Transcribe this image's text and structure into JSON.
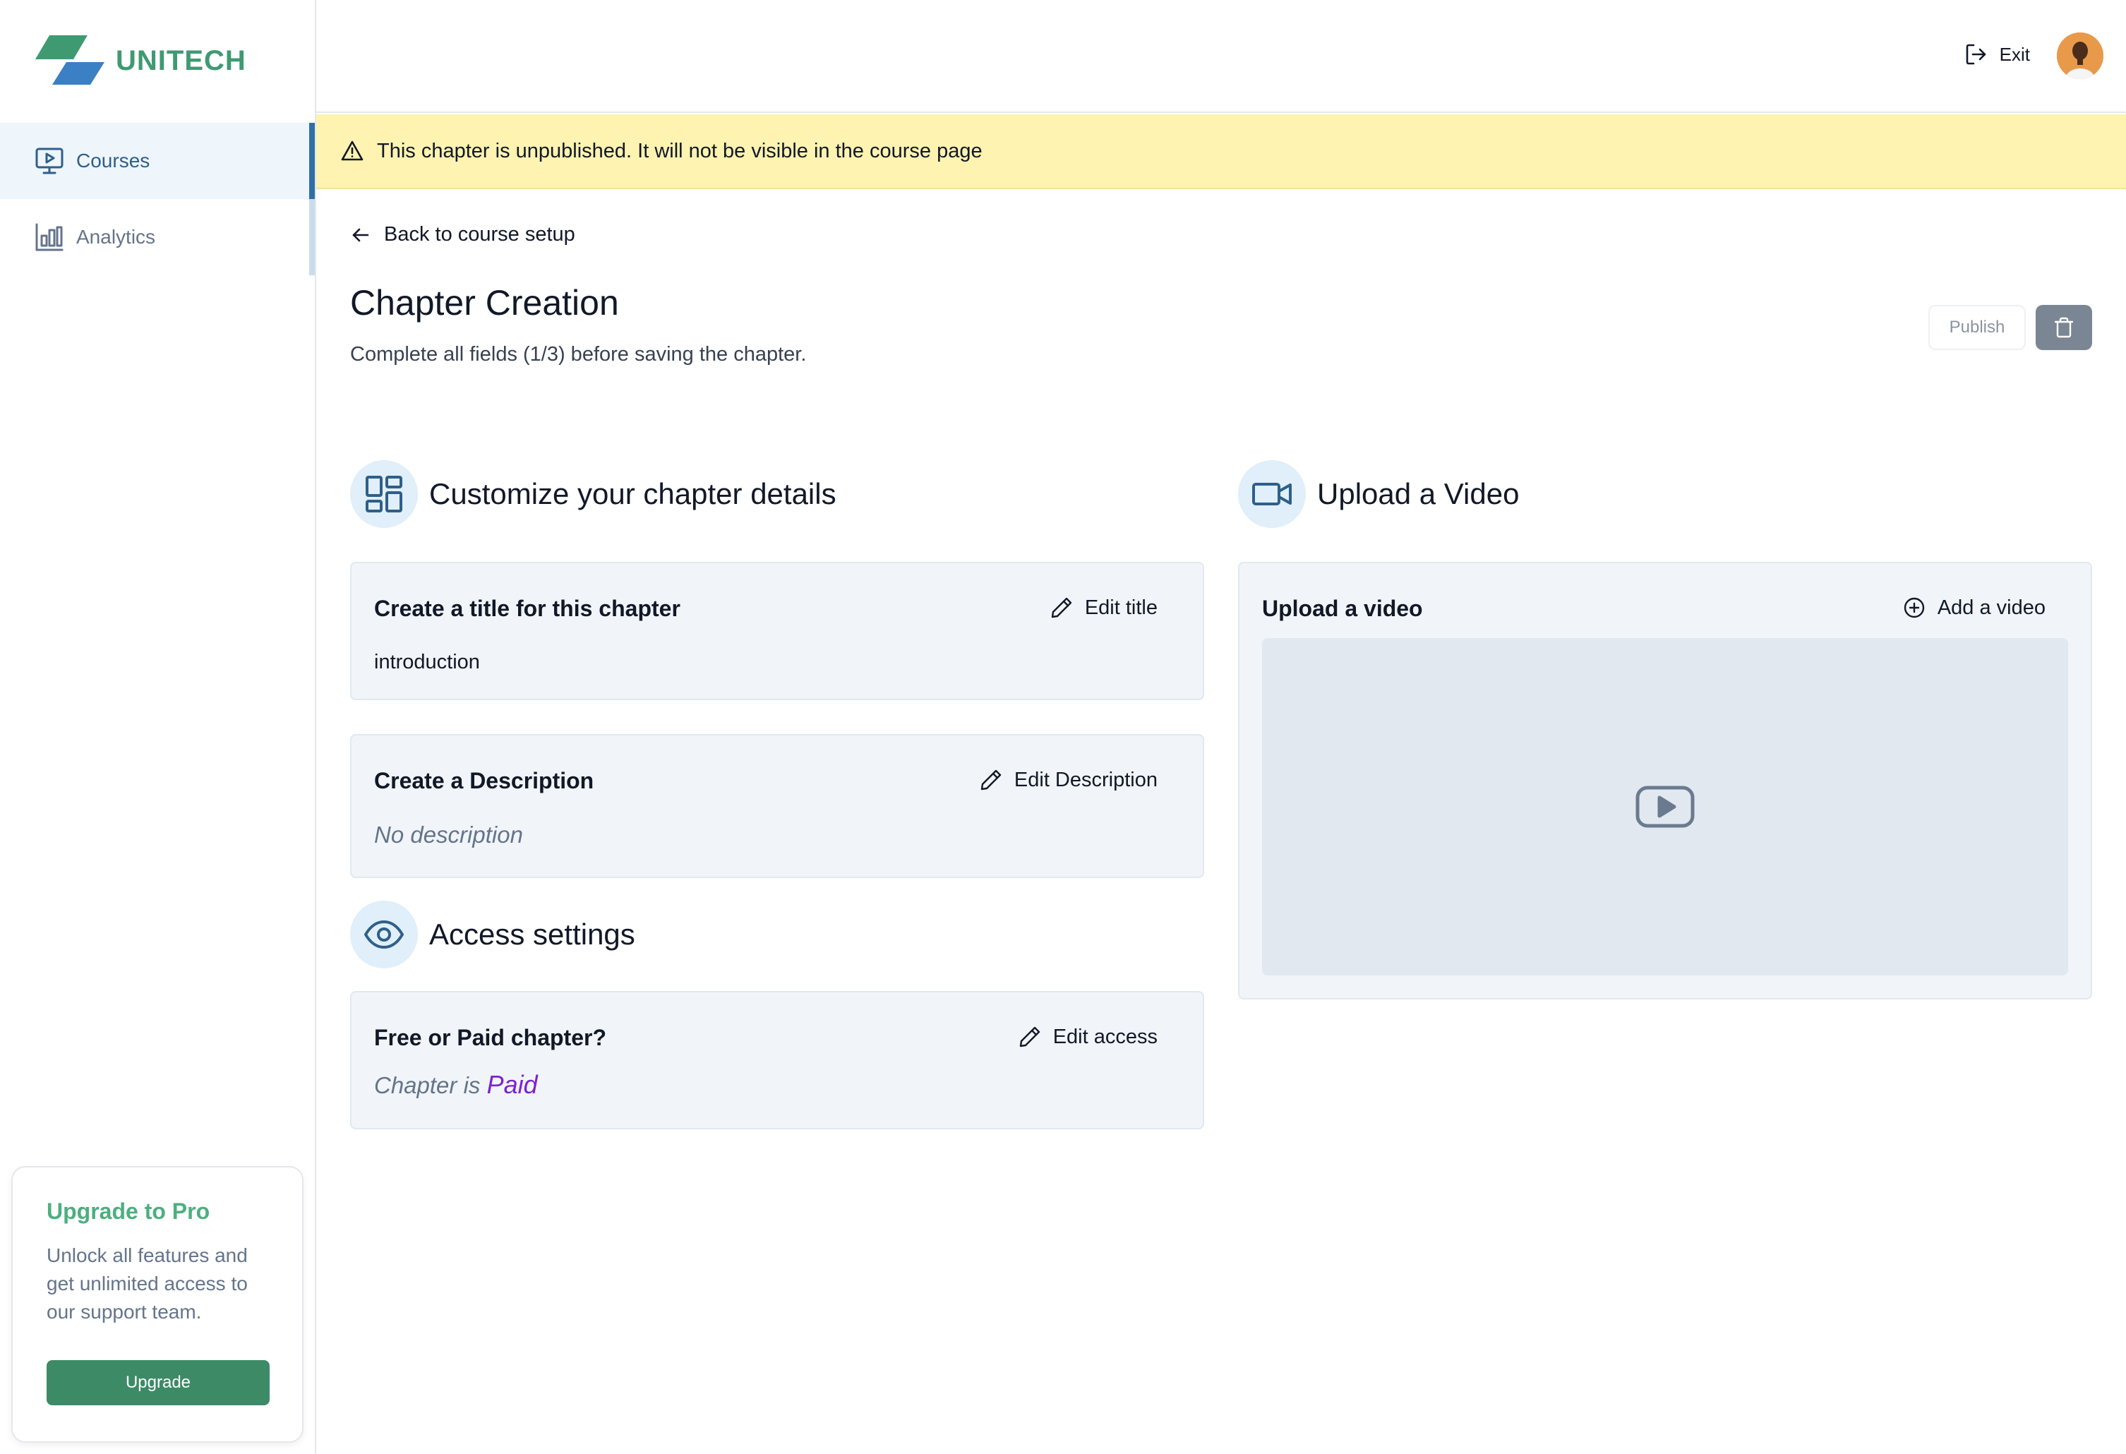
{
  "brand": {
    "name": "UNITECH",
    "green": "#3f9a72",
    "blue": "#3b7fc4"
  },
  "sidebar": {
    "items": [
      {
        "label": "Courses",
        "icon": "monitor-play-icon",
        "active": true
      },
      {
        "label": "Analytics",
        "icon": "bar-chart-icon",
        "active": false
      }
    ],
    "upgrade": {
      "title": "Upgrade to Pro",
      "text": "Unlock all features and get unlimited access to our support team.",
      "button": "Upgrade"
    }
  },
  "topbar": {
    "exit_label": "Exit",
    "avatar": "user-avatar"
  },
  "banner": {
    "icon": "warning-triangle-icon",
    "text": "This chapter is unpublished. It will not be visible in the course page",
    "color": "#fef3b0"
  },
  "main": {
    "back_label": "Back to course setup",
    "title": "Chapter Creation",
    "subtitle": "Complete all fields (1/3) before saving the chapter.",
    "publish_label": "Publish",
    "delete_icon": "trash-icon",
    "sections": {
      "customize": {
        "title": "Customize your chapter details",
        "icon": "layout-dashboard-icon",
        "title_card": {
          "heading": "Create a title for this chapter",
          "action": "Edit title",
          "value": "introduction"
        },
        "description_card": {
          "heading": "Create a Description",
          "action": "Edit Description",
          "value": "No description"
        }
      },
      "access": {
        "title": "Access settings",
        "icon": "eye-icon",
        "card": {
          "heading": "Free or Paid chapter?",
          "action": "Edit access",
          "prefix": "Chapter is",
          "value": "Paid"
        }
      },
      "video": {
        "title": "Upload a Video",
        "icon": "video-camera-icon",
        "card": {
          "heading": "Upload a video",
          "action": "Add a video",
          "placeholder_icon": "youtube-play-icon"
        }
      }
    }
  }
}
